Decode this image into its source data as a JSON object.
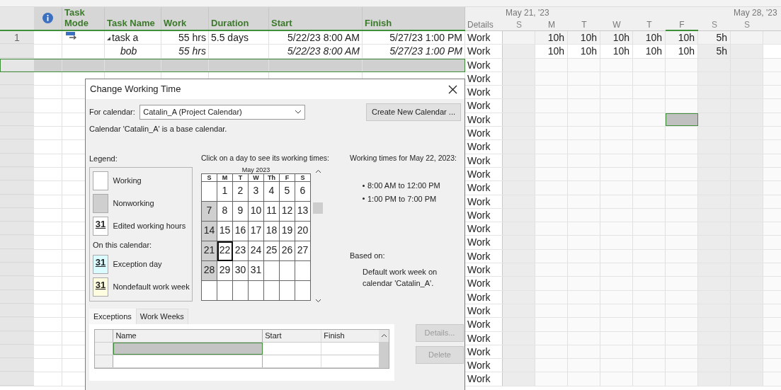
{
  "table": {
    "columns": [
      {
        "kind": "info"
      },
      {
        "kind": "text",
        "label": "Task Mode"
      },
      {
        "kind": "text",
        "label": "Task Name"
      },
      {
        "kind": "text",
        "label": "Work"
      },
      {
        "kind": "text",
        "label": "Duration"
      },
      {
        "kind": "text",
        "label": "Start"
      },
      {
        "kind": "text",
        "label": "Finish"
      }
    ],
    "rows": [
      {
        "kind": "task",
        "number": "1",
        "expanded": true,
        "selected": false,
        "name": "task a",
        "work": "55 hrs",
        "duration": "5.5 days",
        "start": "5/22/23 8:00 AM",
        "finish": "5/27/23 1:00 PM"
      },
      {
        "kind": "assignment",
        "selected": false,
        "name": "bob",
        "work": "55 hrs",
        "start": "5/22/23 8:00 AM",
        "finish": "5/27/23 1:00 PM"
      },
      {
        "kind": "blank",
        "selected": true
      }
    ]
  },
  "timescale": {
    "details_label": "Details",
    "weeks": [
      {
        "label": "May 21, '23"
      },
      {
        "label": "May 28, '23"
      }
    ],
    "days": [
      {
        "label": "S",
        "weekend": true,
        "selected": false
      },
      {
        "label": "M",
        "weekend": false,
        "selected": false
      },
      {
        "label": "T",
        "weekend": false,
        "selected": false
      },
      {
        "label": "W",
        "weekend": false,
        "selected": false
      },
      {
        "label": "T",
        "weekend": false,
        "selected": false
      },
      {
        "label": "F",
        "weekend": false,
        "selected": true
      },
      {
        "label": "S",
        "weekend": true,
        "selected": false
      },
      {
        "label": "S",
        "weekend": true,
        "selected": false
      }
    ],
    "rows": [
      {
        "detail": "Work",
        "kind": "task",
        "cells": [
          {
            "selected": false
          },
          {
            "value": "10h",
            "selected": false
          },
          {
            "value": "10h",
            "selected": false
          },
          {
            "value": "10h",
            "selected": false
          },
          {
            "value": "10h",
            "selected": false
          },
          {
            "value": "10h",
            "selected": false
          },
          {
            "value": "5h",
            "selected": false
          },
          {
            "selected": false
          }
        ]
      },
      {
        "detail": "Work",
        "kind": "assignment",
        "cells": [
          {
            "selected": false
          },
          {
            "value": "10h",
            "selected": false
          },
          {
            "value": "10h",
            "selected": false
          },
          {
            "value": "10h",
            "selected": false
          },
          {
            "value": "10h",
            "selected": false
          },
          {
            "value": "10h",
            "selected": false
          },
          {
            "value": "5h",
            "selected": false
          },
          {
            "selected": false
          }
        ]
      },
      {
        "detail": "Work",
        "kind": "blank"
      },
      {
        "detail": "Work",
        "kind": "blank"
      },
      {
        "detail": "Work",
        "kind": "blank"
      },
      {
        "detail": "Work",
        "kind": "blank"
      },
      {
        "detail": "Work",
        "kind": "blank",
        "cells": [
          {
            "selected": false
          },
          {
            "selected": false
          },
          {
            "selected": false
          },
          {
            "selected": false
          },
          {
            "selected": false
          },
          {
            "selected": true
          },
          {
            "selected": false
          },
          {
            "selected": false
          }
        ]
      },
      {
        "detail": "Work",
        "kind": "blank"
      },
      {
        "detail": "Work",
        "kind": "blank"
      },
      {
        "detail": "Work",
        "kind": "blank"
      },
      {
        "detail": "Work",
        "kind": "blank"
      },
      {
        "detail": "Work",
        "kind": "blank"
      },
      {
        "detail": "Work",
        "kind": "blank"
      },
      {
        "detail": "Work",
        "kind": "blank"
      },
      {
        "detail": "Work",
        "kind": "blank"
      },
      {
        "detail": "Work",
        "kind": "blank"
      },
      {
        "detail": "Work",
        "kind": "blank"
      },
      {
        "detail": "Work",
        "kind": "blank"
      },
      {
        "detail": "Work",
        "kind": "blank"
      },
      {
        "detail": "Work",
        "kind": "blank"
      },
      {
        "detail": "Work",
        "kind": "blank"
      },
      {
        "detail": "Work",
        "kind": "blank"
      },
      {
        "detail": "Work",
        "kind": "blank"
      },
      {
        "detail": "Work",
        "kind": "blank"
      },
      {
        "detail": "Work",
        "kind": "blank"
      },
      {
        "detail": "Work",
        "kind": "blank"
      }
    ]
  },
  "dialog": {
    "title": "Change Working Time",
    "calendar_label": "For calendar:",
    "calendar_value": "Catalin_A (Project Calendar)",
    "create_button": "Create New Calendar ...",
    "info": "Calendar 'Catalin_A' is a base calendar.",
    "legend": {
      "title": "Legend:",
      "items": [
        {
          "kind": "working",
          "label": "Working"
        },
        {
          "kind": "nonworking",
          "label": "Nonworking"
        },
        {
          "kind": "edited",
          "swatch": "31",
          "label": "Edited working hours"
        },
        {
          "kind": "heading",
          "label": "On this calendar:"
        },
        {
          "kind": "exception",
          "swatch": "31",
          "label": "Exception day"
        },
        {
          "kind": "nondefault",
          "swatch": "31",
          "label": "Nondefault work week"
        }
      ]
    },
    "calendar": {
      "instruction": "Click on a day to see its working times:",
      "month": "May 2023",
      "weekdays": [
        "S",
        "M",
        "T",
        "W",
        "Th",
        "F",
        "S"
      ],
      "weeks": [
        [
          {
            "nonworking": false,
            "selected": false
          },
          {
            "day": "1",
            "nonworking": false,
            "selected": false
          },
          {
            "day": "2",
            "nonworking": false,
            "selected": false
          },
          {
            "day": "3",
            "nonworking": false,
            "selected": false
          },
          {
            "day": "4",
            "nonworking": false,
            "selected": false
          },
          {
            "day": "5",
            "nonworking": false,
            "selected": false
          },
          {
            "day": "6",
            "nonworking": false,
            "selected": false
          }
        ],
        [
          {
            "day": "7",
            "nonworking": true,
            "selected": false
          },
          {
            "day": "8",
            "nonworking": false,
            "selected": false
          },
          {
            "day": "9",
            "nonworking": false,
            "selected": false
          },
          {
            "day": "10",
            "nonworking": false,
            "selected": false
          },
          {
            "day": "11",
            "nonworking": false,
            "selected": false
          },
          {
            "day": "12",
            "nonworking": false,
            "selected": false
          },
          {
            "day": "13",
            "nonworking": false,
            "selected": false
          }
        ],
        [
          {
            "day": "14",
            "nonworking": true,
            "selected": false
          },
          {
            "day": "15",
            "nonworking": false,
            "selected": false
          },
          {
            "day": "16",
            "nonworking": false,
            "selected": false
          },
          {
            "day": "17",
            "nonworking": false,
            "selected": false
          },
          {
            "day": "18",
            "nonworking": false,
            "selected": false
          },
          {
            "day": "19",
            "nonworking": false,
            "selected": false
          },
          {
            "day": "20",
            "nonworking": false,
            "selected": false
          }
        ],
        [
          {
            "day": "21",
            "nonworking": true,
            "selected": false
          },
          {
            "day": "22",
            "nonworking": false,
            "selected": true
          },
          {
            "day": "23",
            "nonworking": false,
            "selected": false
          },
          {
            "day": "24",
            "nonworking": false,
            "selected": false
          },
          {
            "day": "25",
            "nonworking": false,
            "selected": false
          },
          {
            "day": "26",
            "nonworking": false,
            "selected": false
          },
          {
            "day": "27",
            "nonworking": false,
            "selected": false
          }
        ],
        [
          {
            "day": "28",
            "nonworking": true,
            "selected": false
          },
          {
            "day": "29",
            "nonworking": false,
            "selected": false
          },
          {
            "day": "30",
            "nonworking": false,
            "selected": false
          },
          {
            "day": "31",
            "nonworking": false,
            "selected": false
          },
          {
            "nonworking": false,
            "selected": false
          },
          {
            "nonworking": false,
            "selected": false
          },
          {
            "nonworking": false,
            "selected": false
          }
        ],
        [
          {
            "nonworking": false,
            "selected": false
          },
          {
            "nonworking": false,
            "selected": false
          },
          {
            "nonworking": false,
            "selected": false
          },
          {
            "nonworking": false,
            "selected": false
          },
          {
            "nonworking": false,
            "selected": false
          },
          {
            "nonworking": false,
            "selected": false
          },
          {
            "nonworking": false,
            "selected": false
          }
        ]
      ]
    },
    "working_times": {
      "title": "Working times for May 22, 2023:",
      "times": [
        "8:00 AM to 12:00 PM",
        "1:00 PM to 7:00 PM"
      ],
      "based_on_label": "Based on:",
      "based_on": "Default work week on calendar 'Catalin_A'."
    },
    "tabs": [
      {
        "label": "Exceptions",
        "selected": true
      },
      {
        "label": "Work Weeks",
        "selected": false
      }
    ],
    "exceptions": {
      "columns": [
        "Name",
        "Start",
        "Finish"
      ],
      "rows": [
        {
          "selected": true
        },
        {
          "selected": false
        }
      ]
    },
    "side_buttons": [
      {
        "label": "Details...",
        "disabled": true
      },
      {
        "label": "Delete",
        "disabled": true
      }
    ]
  }
}
